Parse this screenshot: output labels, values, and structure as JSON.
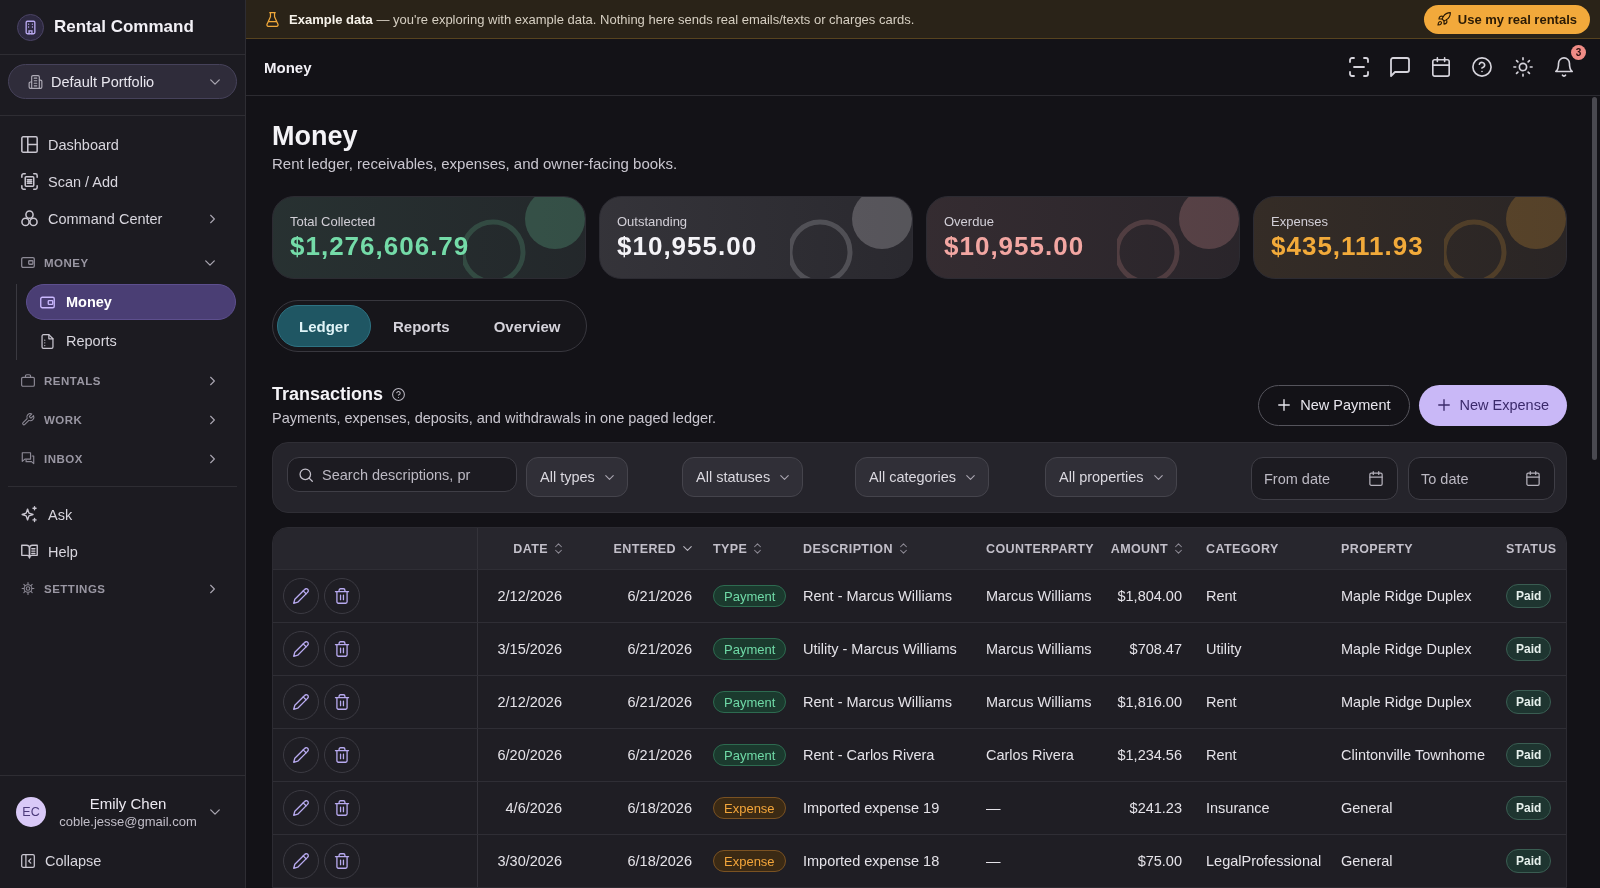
{
  "sidebar": {
    "brand": "Rental Command",
    "portfolio": "Default Portfolio",
    "nav": [
      {
        "kind": "link",
        "label": "Dashboard",
        "selected": false
      },
      {
        "kind": "link",
        "label": "Scan / Add",
        "selected": false
      },
      {
        "kind": "link",
        "label": "Command Center",
        "selected": false,
        "expanded": false
      },
      {
        "kind": "section",
        "label": "MONEY",
        "expanded": true,
        "children": [
          {
            "label": "Money",
            "selected": true
          },
          {
            "label": "Reports",
            "selected": false
          }
        ]
      },
      {
        "kind": "section",
        "label": "RENTALS",
        "expanded": false
      },
      {
        "kind": "section",
        "label": "WORK",
        "expanded": false
      },
      {
        "kind": "section",
        "label": "INBOX",
        "expanded": false
      }
    ],
    "nav_secondary": [
      {
        "kind": "link",
        "label": "Ask",
        "selected": false
      },
      {
        "kind": "link",
        "label": "Help",
        "selected": false
      },
      {
        "kind": "section",
        "label": "SETTINGS",
        "expanded": false
      }
    ],
    "user": {
      "initials": "EC",
      "name": "Emily Chen",
      "email": "coble.jesse@gmail.com"
    },
    "collapse": "Collapse"
  },
  "banner": {
    "message": "**Example data** — you're exploring with example data. Nothing here sends real emails/texts or charges cards.",
    "button": "Use my real rentals"
  },
  "top_bar": {
    "title": "Money",
    "notification_count": "3"
  },
  "page": {
    "title": "Money",
    "subtitle": "Rent ledger, receivables, expenses, and owner-facing books."
  },
  "stats": [
    {
      "label": "Total Collected",
      "value": "$1,276,606.79",
      "color": "#74dba8"
    },
    {
      "label": "Outstanding",
      "value": "$10,955.00",
      "color": "#f4f3f7"
    },
    {
      "label": "Overdue",
      "value": "$10,955.00",
      "color": "#f2a6a2"
    },
    {
      "label": "Expenses",
      "value": "$435,111.93",
      "color": "#f2aa3a"
    }
  ],
  "tabs": [
    {
      "label": "Ledger",
      "selected": true
    },
    {
      "label": "Reports",
      "selected": false
    },
    {
      "label": "Overview",
      "selected": false
    }
  ],
  "transactions": {
    "title": "Transactions",
    "subtitle": "Payments, expenses, deposits, and withdrawals in one paged ledger.",
    "buttons": [
      {
        "label": "New Payment",
        "kind": "secondary"
      },
      {
        "label": "New Expense",
        "kind": "primary"
      }
    ]
  },
  "filters": {
    "search": {
      "placeholder": "Search descriptions, pr"
    },
    "selects": [
      {
        "value": "All types"
      },
      {
        "value": "All statuses"
      },
      {
        "value": "All categories"
      },
      {
        "value": "All properties"
      }
    ],
    "dates": [
      {
        "placeholder": "From date"
      },
      {
        "placeholder": "To date"
      }
    ]
  },
  "table": {
    "columns": [
      {
        "label": "DATE",
        "sortable": true,
        "sorted": false
      },
      {
        "label": "ENTERED",
        "sortable": true,
        "sorted": true
      },
      {
        "label": "TYPE",
        "sortable": true,
        "sorted": false
      },
      {
        "label": "DESCRIPTION",
        "sortable": true,
        "sorted": false
      },
      {
        "label": "COUNTERPARTY",
        "sortable": false,
        "sorted": false
      },
      {
        "label": "AMOUNT",
        "sortable": true,
        "sorted": false
      },
      {
        "label": "CATEGORY",
        "sortable": false,
        "sorted": false
      },
      {
        "label": "PROPERTY",
        "sortable": false,
        "sorted": false
      },
      {
        "label": "STATUS",
        "sortable": false,
        "sorted": false
      }
    ],
    "rows": [
      {
        "date": "2/12/2026",
        "entered": "6/21/2026",
        "type": "Payment",
        "kind": "payment",
        "description": "Rent - Marcus Williams",
        "counterparty": "Marcus Williams",
        "amount": "$1,804.00",
        "category": "Rent",
        "property": "Maple Ridge Duplex",
        "status": "Paid"
      },
      {
        "date": "3/15/2026",
        "entered": "6/21/2026",
        "type": "Payment",
        "kind": "payment",
        "description": "Utility - Marcus Williams",
        "counterparty": "Marcus Williams",
        "amount": "$708.47",
        "category": "Utility",
        "property": "Maple Ridge Duplex",
        "status": "Paid"
      },
      {
        "date": "2/12/2026",
        "entered": "6/21/2026",
        "type": "Payment",
        "kind": "payment",
        "description": "Rent - Marcus Williams",
        "counterparty": "Marcus Williams",
        "amount": "$1,816.00",
        "category": "Rent",
        "property": "Maple Ridge Duplex",
        "status": "Paid"
      },
      {
        "date": "6/20/2026",
        "entered": "6/21/2026",
        "type": "Payment",
        "kind": "payment",
        "description": "Rent - Carlos Rivera",
        "counterparty": "Carlos Rivera",
        "amount": "$1,234.56",
        "category": "Rent",
        "property": "Clintonville Townhome",
        "status": "Paid"
      },
      {
        "date": "4/6/2026",
        "entered": "6/18/2026",
        "type": "Expense",
        "kind": "expense",
        "description": "Imported expense 19",
        "counterparty": "—",
        "amount": "$241.23",
        "category": "Insurance",
        "property": "General",
        "status": "Paid"
      },
      {
        "date": "3/30/2026",
        "entered": "6/18/2026",
        "type": "Expense",
        "kind": "expense",
        "description": "Imported expense 18",
        "counterparty": "—",
        "amount": "$75.00",
        "category": "LegalProfessional",
        "property": "General",
        "status": "Paid"
      }
    ]
  }
}
